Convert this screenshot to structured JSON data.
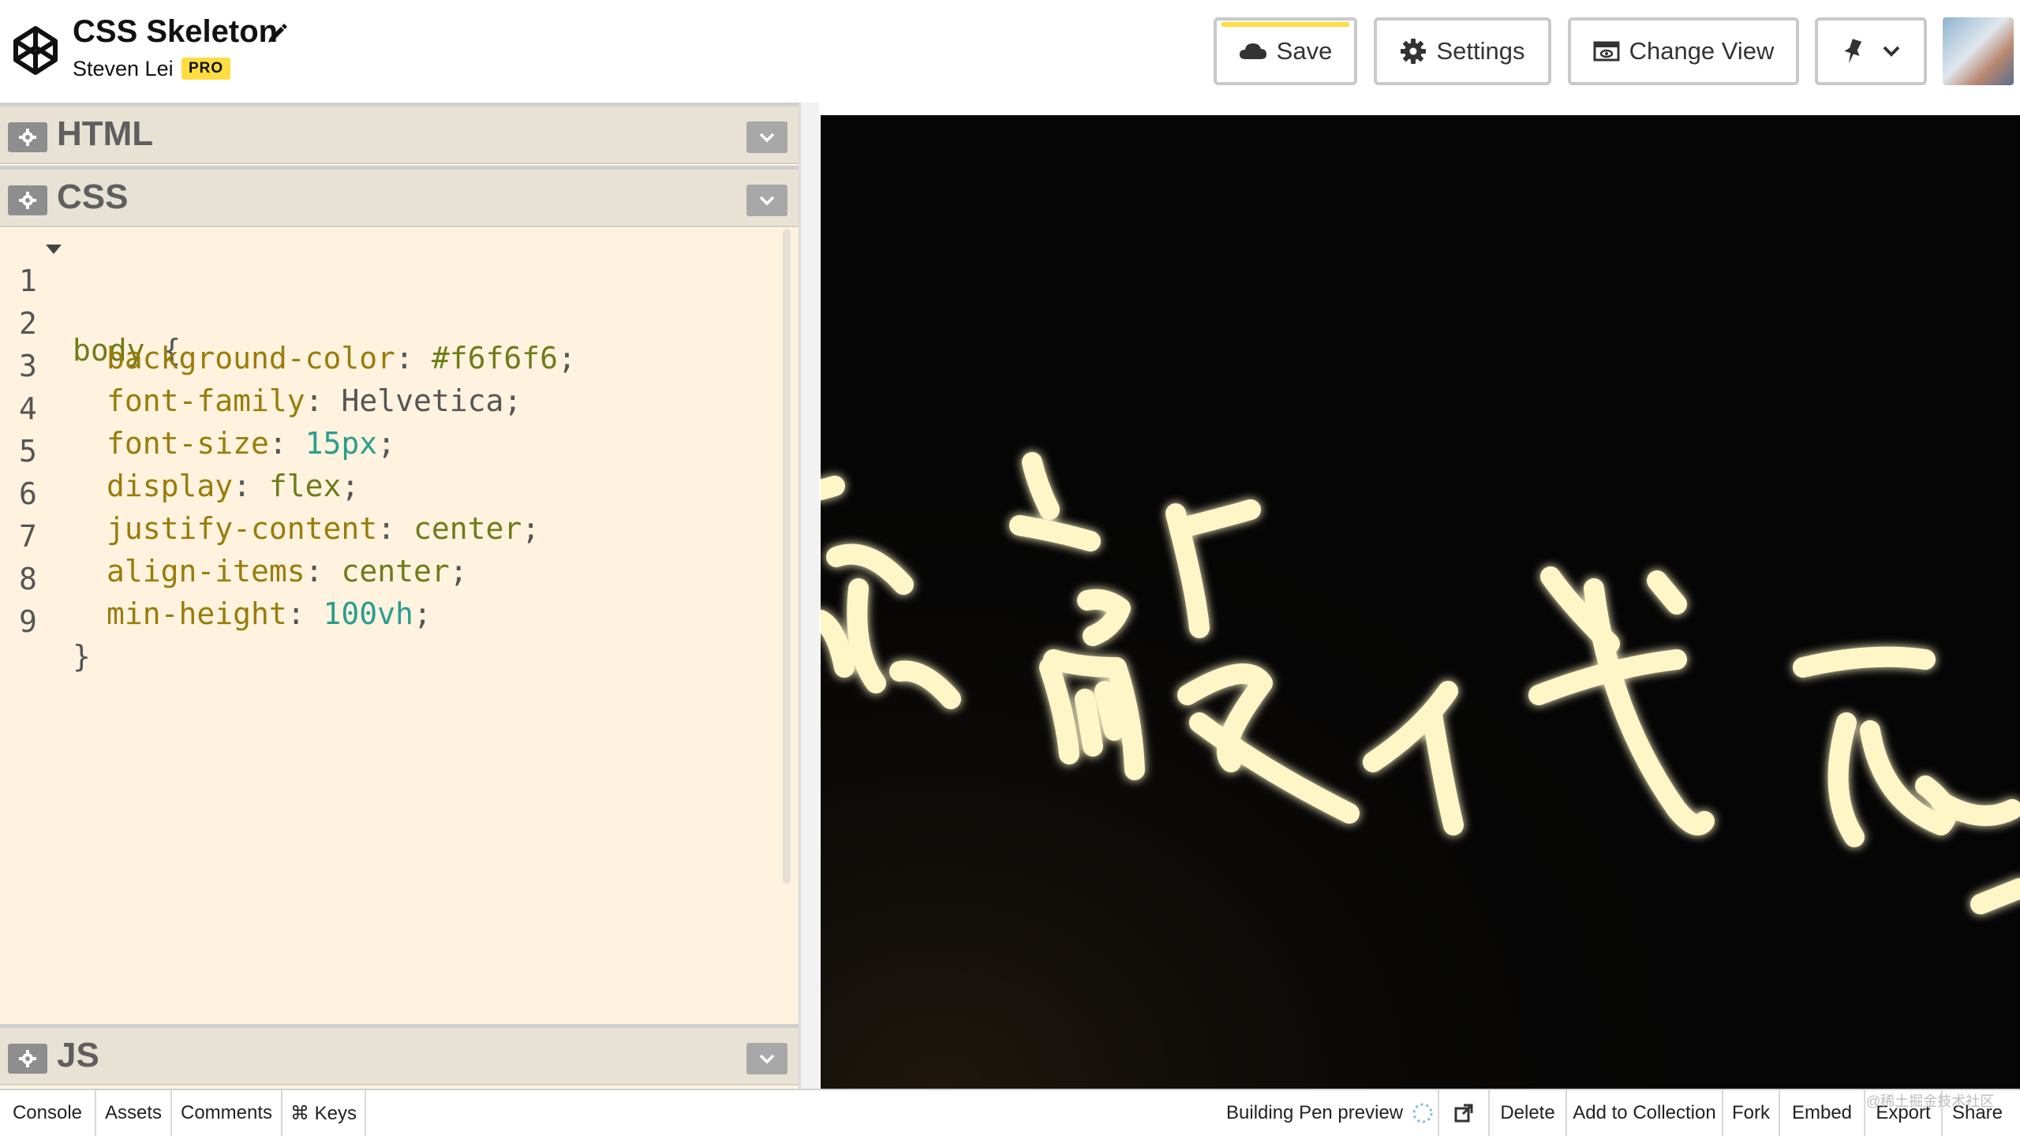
{
  "header": {
    "pen_title": "CSS Skeleton",
    "author": "Steven Lei",
    "badge": "PRO",
    "buttons": {
      "save": "Save",
      "settings": "Settings",
      "change_view": "Change View"
    }
  },
  "panels": {
    "html": "HTML",
    "css": "CSS",
    "js": "JS"
  },
  "css_code": {
    "line_numbers": [
      "1",
      "2",
      "3",
      "4",
      "5",
      "6",
      "7",
      "8",
      "9"
    ],
    "selector": "body",
    "open_brace": "{",
    "close_brace": "}",
    "declarations": [
      {
        "prop": "background-color",
        "value": "#f6f6f6"
      },
      {
        "prop": "font-family",
        "value": "Helvetica"
      },
      {
        "prop": "font-size",
        "value": "15px"
      },
      {
        "prop": "display",
        "value": "flex"
      },
      {
        "prop": "justify-content",
        "value": "center"
      },
      {
        "prop": "align-items",
        "value": "center"
      },
      {
        "prop": "min-height",
        "value": "100vh"
      }
    ]
  },
  "footer": {
    "console": "Console",
    "assets": "Assets",
    "comments": "Comments",
    "keys": "⌘ Keys",
    "status": "Building Pen preview",
    "delete": "Delete",
    "add_to_collection": "Add to Collection",
    "fork": "Fork",
    "embed": "Embed",
    "export": "Export",
    "share": "Share",
    "watermark": "@稀土掘金技术社区"
  },
  "colors": {
    "accent": "#ffdd40",
    "editor_bg": "#fff3e0",
    "panel_header": "#e8e2d5",
    "preview_bg": "#050505",
    "neon": "#fff6c8"
  },
  "preview": {
    "description_glyphs": "neon handwriting"
  }
}
